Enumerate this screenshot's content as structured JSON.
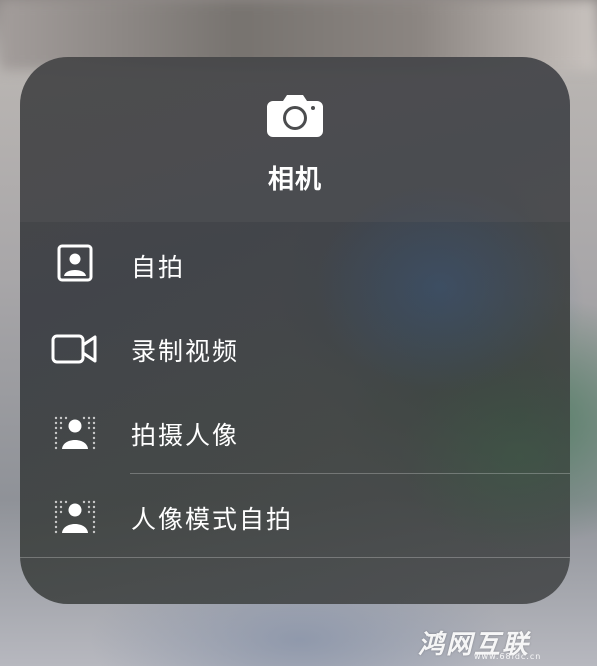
{
  "app": {
    "title": "相机",
    "icon": "camera-icon"
  },
  "actions": [
    {
      "label": "自拍",
      "icon": "selfie-portrait-icon"
    },
    {
      "label": "录制视频",
      "icon": "video-camera-icon"
    },
    {
      "label": "拍摄人像",
      "icon": "portrait-mode-icon"
    },
    {
      "label": "人像模式自拍",
      "icon": "portrait-selfie-icon"
    }
  ],
  "watermark": {
    "text": "鸿网互联",
    "sub": "www.68idc.cn"
  }
}
